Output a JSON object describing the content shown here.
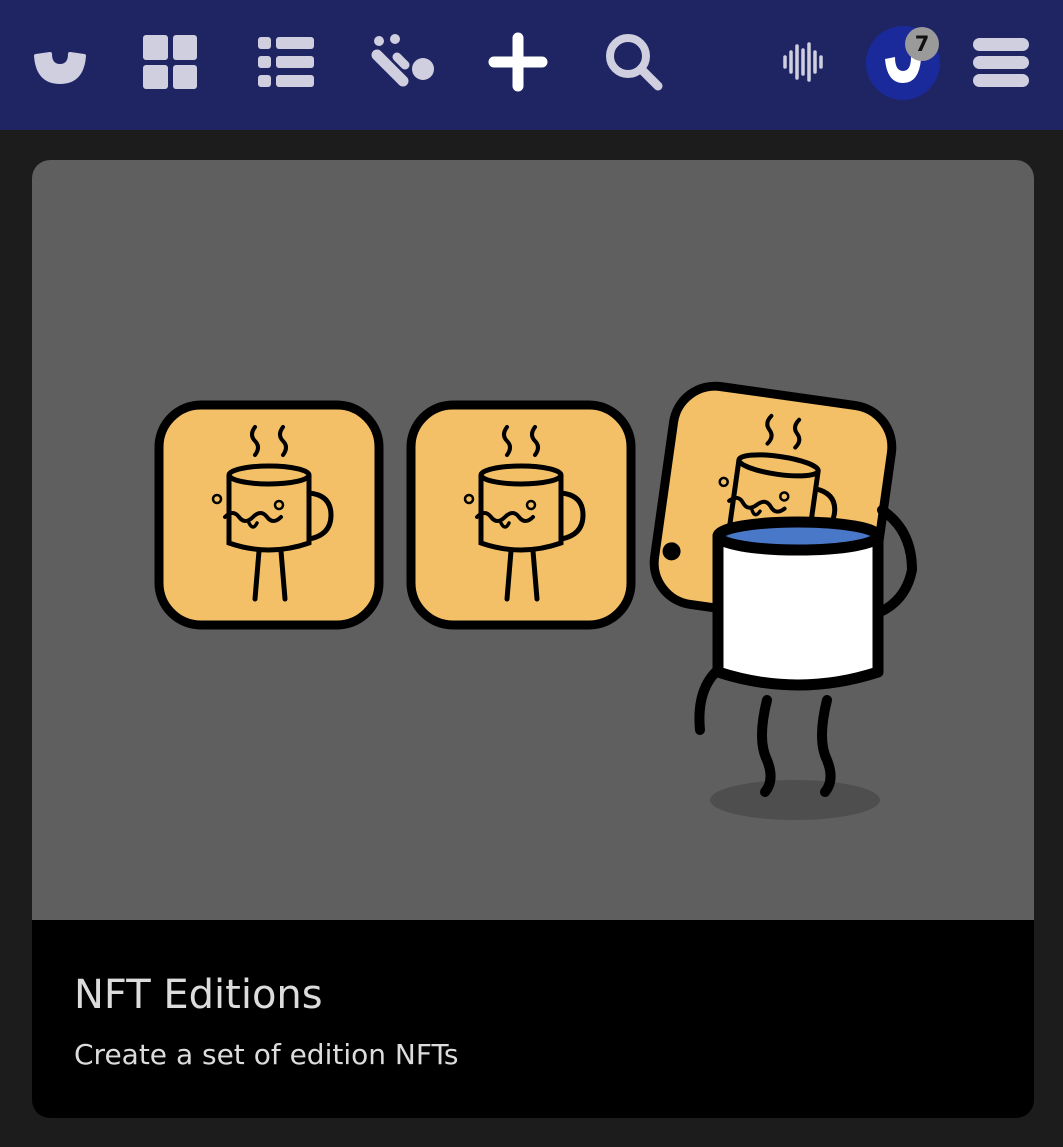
{
  "nav": {
    "icons": [
      "logo-icon",
      "grid-icon",
      "list-icon",
      "activity-icon",
      "plus-icon",
      "search-icon",
      "audio-wave-icon",
      "account-avatar-icon",
      "menu-icon"
    ],
    "notification_count": "7",
    "colors": {
      "bar": "#1f2563",
      "icon": "#cfcfe0",
      "plus": "#ffffff",
      "avatar": "#1b2a9a",
      "badge": "#9a9a9a"
    }
  },
  "card": {
    "title": "NFT Editions",
    "subtitle": "Create a set of edition NFTs",
    "art_icons": [
      "coffee-tile-icon",
      "coffee-tile-icon",
      "coffee-tile-icon",
      "mug-character-icon"
    ],
    "colors": {
      "tile": "#f3c067",
      "art_bg": "#5f5f5f",
      "liquid": "#4a78c8"
    }
  }
}
